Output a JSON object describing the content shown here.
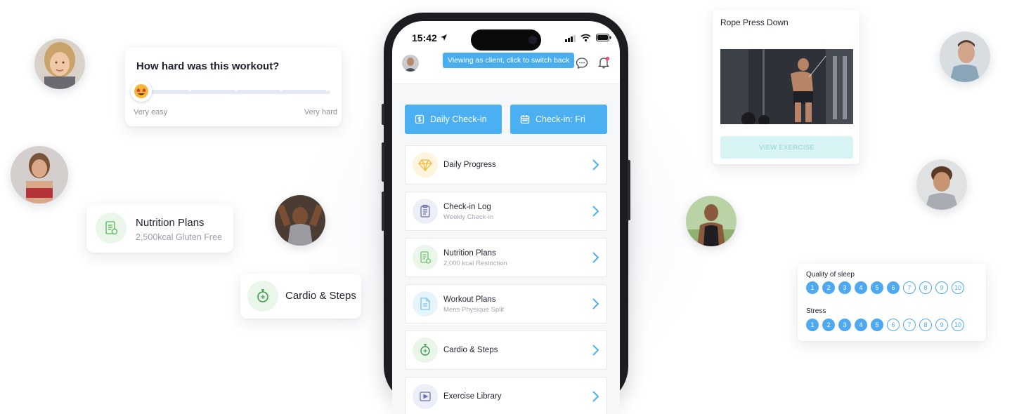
{
  "workout_card": {
    "title": "How hard was this workout?",
    "low_label": "Very easy",
    "high_label": "Very hard",
    "thumb_icon": "star-struck-emoji-icon"
  },
  "nutrition_card": {
    "title": "Nutrition Plans",
    "subtitle": "2,500kcal Gluten Free",
    "icon": "meal-plan-icon"
  },
  "cardio_card": {
    "title": "Cardio & Steps",
    "icon": "stopwatch-icon"
  },
  "phone": {
    "status_time": "15:42",
    "tooltip": "Viewing as client, click to switch back",
    "checkin_buttons": [
      {
        "label": "Daily Check-in",
        "icon": "dollar-square-icon"
      },
      {
        "label": "Check-in: Fri",
        "icon": "calendar-icon"
      }
    ],
    "menu": [
      {
        "title": "Daily Progress",
        "subtitle": "",
        "icon": "diamond-icon"
      },
      {
        "title": "Check-in Log",
        "subtitle": "Weekly Check-in",
        "icon": "clipboard-icon"
      },
      {
        "title": "Nutrition Plans",
        "subtitle": "2,000 kcal Restriction",
        "icon": "meal-plan-icon"
      },
      {
        "title": "Workout Plans",
        "subtitle": "Mens Physique Split",
        "icon": "document-icon"
      },
      {
        "title": "Cardio & Steps",
        "subtitle": "",
        "icon": "stopwatch-icon"
      },
      {
        "title": "Exercise Library",
        "subtitle": "",
        "icon": "video-icon"
      }
    ]
  },
  "exercise_card": {
    "title": "Rope Press Down",
    "button": "VIEW EXERCISE"
  },
  "rating_card": {
    "sleep_label": "Quality of sleep",
    "sleep_value": 6,
    "stress_label": "Stress",
    "stress_value": 5,
    "scale": [
      "1",
      "2",
      "3",
      "4",
      "5",
      "6",
      "7",
      "8",
      "9",
      "10"
    ]
  },
  "colors": {
    "accent": "#4ab0f2",
    "teal_button": "#d7f3f3",
    "green_icon": "#6cc16f"
  }
}
